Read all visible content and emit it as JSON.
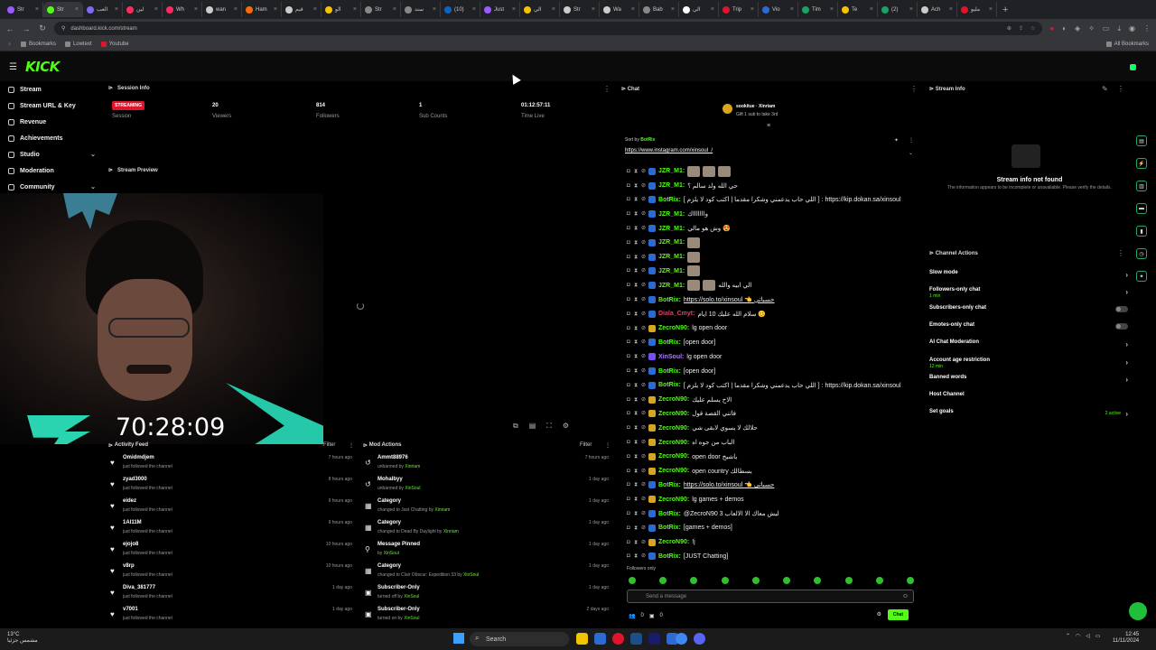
{
  "browser": {
    "tabs": [
      {
        "label": "Str",
        "color": "#9b59ff"
      },
      {
        "label": "Str",
        "color": "#53fc18",
        "active": true
      },
      {
        "label": "العب",
        "color": "#7a6cf5"
      },
      {
        "label": "لين",
        "color": "#ff2a5e"
      },
      {
        "label": "Wh",
        "color": "#ff2a5e"
      },
      {
        "label": "wan",
        "color": "#cccccc"
      },
      {
        "label": "Ham",
        "color": "#ff6a00"
      },
      {
        "label": "قيم",
        "color": "#cccccc"
      },
      {
        "label": "الو",
        "color": "#f3c400"
      },
      {
        "label": "Str",
        "color": "#888888"
      },
      {
        "label": "سند",
        "color": "#888888"
      },
      {
        "label": "(10)",
        "color": "#0a66c2"
      },
      {
        "label": "Just",
        "color": "#9b59ff"
      },
      {
        "label": "الي",
        "color": "#f3c400"
      },
      {
        "label": "Str",
        "color": "#cccccc"
      },
      {
        "label": "Wa",
        "color": "#cccccc"
      },
      {
        "label": "Bab",
        "color": "#888888"
      },
      {
        "label": "الي",
        "color": "#ffffff"
      },
      {
        "label": "Trip",
        "color": "#e0152b"
      },
      {
        "label": "Vio",
        "color": "#2a6ad4"
      },
      {
        "label": "Tim",
        "color": "#1aa260"
      },
      {
        "label": "Te",
        "color": "#f3c400"
      },
      {
        "label": "(2)",
        "color": "#1aa260"
      },
      {
        "label": "Ach",
        "color": "#cccccc"
      },
      {
        "label": "مليو",
        "color": "#e0152b"
      }
    ],
    "url": "dashboard.kick.com/stream",
    "bookmarks": [
      "Bookmarks",
      "Lowtext",
      "Youtube"
    ],
    "bookmarks_right": "All Bookmarks"
  },
  "app": {
    "logo": "KICK",
    "nav": [
      {
        "label": "Stream",
        "chevron": false
      },
      {
        "label": "Stream URL & Key",
        "chevron": false
      },
      {
        "label": "Revenue",
        "chevron": false
      },
      {
        "label": "Achievements",
        "chevron": false
      },
      {
        "label": "Studio",
        "chevron": true
      },
      {
        "label": "Moderation",
        "chevron": false
      },
      {
        "label": "Community",
        "chevron": true
      }
    ]
  },
  "session": {
    "title": "Session Info",
    "status_badge": "STREAMING",
    "status_label": "Session",
    "viewers": "20",
    "viewers_label": "Viewers",
    "followers": "814",
    "followers_label": "Followers",
    "subs": "1",
    "subs_label": "Sub Counts",
    "time_live": "01:12:57:11",
    "time_live_label": "Time Live"
  },
  "preview": {
    "title": "Stream Preview",
    "overlay_timer": "70:28:09"
  },
  "activity": {
    "title": "Activity Feed",
    "filter": "Filter",
    "rows": [
      {
        "name": "Omidmdjem",
        "sub": "just followed the channel",
        "time": "7 hours ago"
      },
      {
        "name": "zyad3000",
        "sub": "just followed the channel",
        "time": "8 hours ago"
      },
      {
        "name": "eidez",
        "sub": "just followed the channel",
        "time": "9 hours ago"
      },
      {
        "name": "1Al11M",
        "sub": "just followed the channel",
        "time": "9 hours ago"
      },
      {
        "name": "ejojo8",
        "sub": "just followed the channel",
        "time": "10 hours ago"
      },
      {
        "name": "v8rp",
        "sub": "just followed the channel",
        "time": "10 hours ago"
      },
      {
        "name": "Diva_381777",
        "sub": "just followed the channel",
        "time": "1 day ago"
      },
      {
        "name": "v7001",
        "sub": "just followed the channel",
        "time": "1 day ago"
      }
    ]
  },
  "mod": {
    "title": "Mod Actions",
    "filter": "Filter",
    "rows": [
      {
        "icon": "unban-icon",
        "name": "Ammt88976",
        "sub": "unbanned by",
        "by": "Xinriam",
        "time": "7 hours ago"
      },
      {
        "icon": "unban-icon",
        "name": "Mohalbyy",
        "sub": "unbanned by",
        "by": "XinSoul",
        "time": "1 day ago"
      },
      {
        "icon": "category-icon",
        "name": "Category",
        "sub": "changed to Just Chatting by",
        "by": "Xinriam",
        "time": "1 day ago"
      },
      {
        "icon": "category-icon",
        "name": "Category",
        "sub": "changed to Dead By Daylight by",
        "by": "Xinriam",
        "time": "1 day ago"
      },
      {
        "icon": "pin-icon",
        "name": "Message Pinned",
        "sub": "by",
        "by": "XinSoul",
        "time": "1 day ago"
      },
      {
        "icon": "category-icon",
        "name": "Category",
        "sub": "changed to Clair Obscur: Expedition 33 by",
        "by": "XinSoul",
        "time": "1 day ago"
      },
      {
        "icon": "subscriber-only-icon",
        "name": "Subscriber-Only",
        "sub": "turned off by",
        "by": "XinSoul",
        "time": "1 day ago"
      },
      {
        "icon": "subscriber-only-icon",
        "name": "Subscriber-Only",
        "sub": "turned on by",
        "by": "XinSoul",
        "time": "2 days ago"
      }
    ]
  },
  "chat": {
    "title": "Chat",
    "pinned_user": "sookitue",
    "pinned_by": "Xinriam",
    "pinned_text": "Gift 1 sub to take 3rd",
    "sort_label": "Sort by",
    "sort_user": "BotRix",
    "ig_url": "https://www.instagram.com/xinsoul_/",
    "messages": [
      {
        "user": "JZR_M1:",
        "color": "#53fc18",
        "badge": "#2a6ad4",
        "text": "",
        "emotes": 3
      },
      {
        "user": "JZR_M1:",
        "color": "#53fc18",
        "badge": "#2a6ad4",
        "text": "حي الله ولد سالم ؟",
        "emotes": 0
      },
      {
        "user": "BotRix:",
        "color": "#53fc18",
        "badge": "#2a6ad4",
        "text": "[ اللي حاب يدعمني وشكرا مقدما | اكتب كود لا يلزم ] : https://kip.dokan.sa/xinsoul",
        "emotes": 0
      },
      {
        "user": "JZR_M1:",
        "color": "#53fc18",
        "badge": "#2a6ad4",
        "text": "واااااااك",
        "emotes": 0
      },
      {
        "user": "JZR_M1:",
        "color": "#53fc18",
        "badge": "#2a6ad4",
        "text": "وش هو مالي 😍",
        "emotes": 0
      },
      {
        "user": "JZR_M1:",
        "color": "#53fc18",
        "badge": "#2a6ad4",
        "text": "",
        "emotes": 1
      },
      {
        "user": "JZR_M1:",
        "color": "#53fc18",
        "badge": "#2a6ad4",
        "text": "",
        "emotes": 1
      },
      {
        "user": "JZR_M1:",
        "color": "#53fc18",
        "badge": "#2a6ad4",
        "text": "",
        "emotes": 1
      },
      {
        "user": "JZR_M1:",
        "color": "#53fc18",
        "badge": "#2a6ad4",
        "text": "الي ابيه والله",
        "emotes": 2
      },
      {
        "user": "BotRix:",
        "color": "#53fc18",
        "badge": "#2a6ad4",
        "text": "https://solo.to/xinsoul 👈 حسباتي",
        "emotes": 0,
        "link": true
      },
      {
        "user": "Diala_Cmyt:",
        "color": "#e0406a",
        "badge": "#2a6ad4",
        "text": "سلام الله عليك 10 ايام 😊",
        "emotes": 0
      },
      {
        "user": "ZecroN90:",
        "color": "#53fc18",
        "badge": "#d9a520",
        "text": "lg open door",
        "emotes": 0
      },
      {
        "user": "BotRix:",
        "color": "#53fc18",
        "badge": "#2a6ad4",
        "text": "[open door]",
        "emotes": 0
      },
      {
        "user": "XinSoul:",
        "color": "#b07cff",
        "badge": "#7a4cf5",
        "text": "lg open door",
        "emotes": 0
      },
      {
        "user": "BotRix:",
        "color": "#53fc18",
        "badge": "#2a6ad4",
        "text": "[open door]",
        "emotes": 0
      },
      {
        "user": "BotRix:",
        "color": "#53fc18",
        "badge": "#2a6ad4",
        "text": "[ اللي حاب يدعمني وشكرا مقدما | اكتب كود لا يلزم ] : https://kip.dokan.sa/xinsoul",
        "emotes": 0
      },
      {
        "user": "ZecroN90:",
        "color": "#53fc18",
        "badge": "#d9a520",
        "text": "الاخ يسلم عليك",
        "emotes": 0
      },
      {
        "user": "ZecroN90:",
        "color": "#53fc18",
        "badge": "#d9a520",
        "text": "فاتني القصة قول",
        "emotes": 0
      },
      {
        "user": "ZecroN90:",
        "color": "#53fc18",
        "badge": "#d9a520",
        "text": "حلالك لا يسوي لابقى شي",
        "emotes": 0
      },
      {
        "user": "ZecroN90:",
        "color": "#53fc18",
        "badge": "#d9a520",
        "text": "الباب من جوه اه",
        "emotes": 0
      },
      {
        "user": "ZecroN90:",
        "color": "#53fc18",
        "badge": "#d9a520",
        "text": "open door ياشيخ",
        "emotes": 0
      },
      {
        "user": "ZecroN90:",
        "color": "#53fc18",
        "badge": "#d9a520",
        "text": "open country يسطالك",
        "emotes": 0
      },
      {
        "user": "BotRix:",
        "color": "#53fc18",
        "badge": "#2a6ad4",
        "text": "https://solo.to/xinsoul 👈 حسباتي",
        "emotes": 0,
        "link": true
      },
      {
        "user": "ZecroN90:",
        "color": "#53fc18",
        "badge": "#d9a520",
        "text": "lg games + demos",
        "emotes": 0
      },
      {
        "user": "BotRix:",
        "color": "#53fc18",
        "badge": "#2a6ad4",
        "text": "@ZecroN90 3 ليش معاك الا الالعاب",
        "emotes": 0
      },
      {
        "user": "BotRix:",
        "color": "#53fc18",
        "badge": "#2a6ad4",
        "text": "[games + demos]",
        "emotes": 0
      },
      {
        "user": "ZecroN90:",
        "color": "#53fc18",
        "badge": "#d9a520",
        "text": "!j",
        "emotes": 0
      },
      {
        "user": "BotRix:",
        "color": "#53fc18",
        "badge": "#2a6ad4",
        "text": "[JUST Chatting]",
        "emotes": 0
      }
    ],
    "followers_only": "Followers only",
    "input_placeholder": "Send a message",
    "footer_count_1": "0",
    "footer_count_2": "0",
    "send_label": "Chat"
  },
  "stream_info": {
    "title": "Stream Info",
    "not_found": "Stream info not found",
    "not_found_sub": "The information appears to be incomplete or unavailable. Please verify the details."
  },
  "channel_actions": {
    "title": "Channel Actions",
    "items": [
      {
        "label": "Slow mode",
        "sub": "",
        "control": "arrow"
      },
      {
        "label": "Followers-only chat",
        "sub": "1 min",
        "control": "arrow"
      },
      {
        "label": "Subscribers-only chat",
        "sub": "",
        "control": "toggle"
      },
      {
        "label": "Emotes-only chat",
        "sub": "",
        "control": "toggle"
      },
      {
        "label": "AI Chat Moderation",
        "sub": "",
        "control": "arrow"
      },
      {
        "label": "Account age restriction",
        "sub": "12 min",
        "control": "arrow"
      },
      {
        "label": "Banned words",
        "sub": "",
        "control": "arrow"
      },
      {
        "label": "Host Channel",
        "sub": "",
        "control": "none"
      },
      {
        "label": "Set goals",
        "sub": "",
        "control": "arrow",
        "meta": "2 active"
      }
    ]
  },
  "taskbar": {
    "weather_temp": "13°C",
    "weather_desc": "مشمس جزئيا",
    "search": "Search",
    "time": "12:45",
    "date": "11/11/2024"
  }
}
